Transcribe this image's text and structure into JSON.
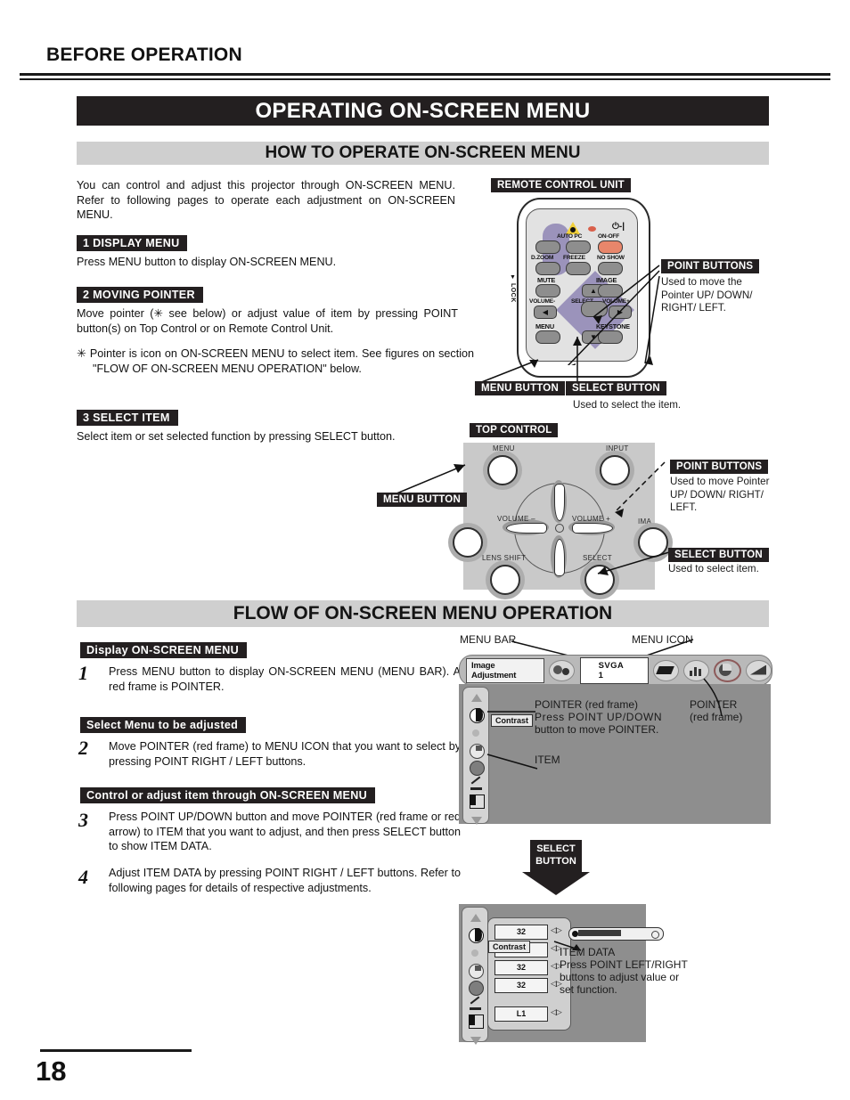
{
  "running_head": "BEFORE OPERATION",
  "page_number": "18",
  "banners": {
    "main": "OPERATING ON-SCREEN MENU",
    "sub1": "HOW TO OPERATE ON-SCREEN MENU",
    "sub2": "FLOW OF ON-SCREEN MENU OPERATION"
  },
  "intro": "You can control and adjust this projector through ON-SCREEN MENU.  Refer to following pages to operate each adjustment on ON-SCREEN MENU.",
  "sections": [
    {
      "tag": "1  DISPLAY MENU",
      "body": "Press MENU button to display ON-SCREEN MENU."
    },
    {
      "tag": "2  MOVING POINTER",
      "body": "Move pointer (✳ see below) or adjust value of item by pressing POINT button(s) on Top Control or on Remote Control Unit."
    },
    {
      "tag": "3  SELECT ITEM",
      "body": "Select item or set selected function by pressing SELECT button."
    }
  ],
  "note": {
    "marker": "✳",
    "text": "Pointer is icon on ON-SCREEN MENU to select item.  See figures on section \"FLOW OF ON-SCREEN MENU OPERATION\" below."
  },
  "remote": {
    "title": "REMOTE CONTROL UNIT",
    "labels": {
      "auto_pc": "AUTO PC",
      "on_off": "ON-OFF",
      "dzoom": "D.ZOOM",
      "freeze": "FREEZE",
      "no_show": "NO SHOW",
      "mute": "MUTE",
      "image": "IMAGE",
      "volume_minus": "VOLUME-",
      "select": "SELECT",
      "volume_plus": "VOLUME+",
      "menu": "MENU",
      "keystone": "KEYSTONE",
      "lock": "▼ LOCK",
      "power_symbol": "⏻-|"
    },
    "callouts": {
      "point_title": "POINT BUTTONS",
      "point_text": "Used to move the Pointer UP/ DOWN/ RIGHT/ LEFT.",
      "menu_title": "MENU BUTTON",
      "select_title": "SELECT BUTTON",
      "select_text": "Used to select the item."
    }
  },
  "top_control": {
    "title": "TOP CONTROL",
    "labels": {
      "menu": "MENU",
      "input": "INPUT",
      "volume_minus": "VOLUME –",
      "volume_plus": "VOLUME +",
      "image": "IMA",
      "lens_shift": "LENS SHIFT",
      "select": "SELECT"
    },
    "callouts": {
      "menu_title": "MENU BUTTON",
      "point_title": "POINT BUTTONS",
      "point_text": "Used to move Pointer UP/ DOWN/ RIGHT/ LEFT.",
      "select_title": "SELECT BUTTON",
      "select_text": "Used to select item."
    }
  },
  "flow": {
    "steps": [
      {
        "tag": "Display ON-SCREEN MENU",
        "num": "1",
        "text": "Press MENU button to display ON-SCREEN MENU (MENU BAR).  A red frame is POINTER."
      },
      {
        "tag": "Select Menu to be adjusted",
        "num": "2",
        "text": "Move POINTER (red frame) to MENU ICON that you want to select by pressing POINT RIGHT / LEFT buttons."
      },
      {
        "tag": "Control or adjust item through ON-SCREEN MENU",
        "num": "3",
        "text": "Press POINT UP/DOWN button and move POINTER (red frame or red arrow) to ITEM that you want to adjust, and then press SELECT button to show ITEM DATA."
      },
      {
        "tag": "",
        "num": "4",
        "text": "Adjust ITEM DATA by pressing POINT RIGHT / LEFT buttons. Refer to following pages for details of respective adjustments."
      }
    ],
    "callouts": {
      "menu_bar": "MENU BAR",
      "menu_icon": "MENU ICON",
      "pointer_red_frame_1": "POINTER (red frame)",
      "pointer_instr_1": "Press POINT UP/DOWN",
      "pointer_instr_2": "button to move POINTER.",
      "pointer_right_l1": "POINTER",
      "pointer_right_l2": "(red frame)",
      "item": "ITEM",
      "select_button_l1": "SELECT",
      "select_button_l2": "BUTTON",
      "item_data_title": "ITEM DATA",
      "item_data_l1": "Press POINT LEFT/RIGHT",
      "item_data_l2": "buttons to adjust value or",
      "item_data_l3": "set function."
    }
  },
  "osd_top": {
    "menu_title": "Image Adjustment",
    "source": "SVGA 1",
    "tooltip": "Contrast",
    "icons": [
      "scroll-up-icon",
      "contrast-icon",
      "brightness-icon",
      "color-icon",
      "tint-icon",
      "sharpness-icon",
      "gamma-icon",
      "scroll-down-icon"
    ],
    "bar_icons": [
      "input-icon",
      "computer-icon",
      "bars-icon",
      "image-adjust-icon",
      "screen-icon"
    ]
  },
  "osd_bottom": {
    "tooltip": "Contrast",
    "values": [
      "32",
      "",
      "32",
      "32",
      "L1"
    ],
    "icons": [
      "scroll-up-icon",
      "contrast-icon",
      "brightness-icon",
      "color-icon",
      "tint-icon",
      "sharpness-icon",
      "gamma-icon",
      "scroll-down-icon"
    ]
  },
  "colors": {
    "ink": "#231f20",
    "gray_banner": "#cfcfcf",
    "dpad": "#9b93bb",
    "power_btn": "#e8866b",
    "osd_gray": "#8e8e8e"
  }
}
